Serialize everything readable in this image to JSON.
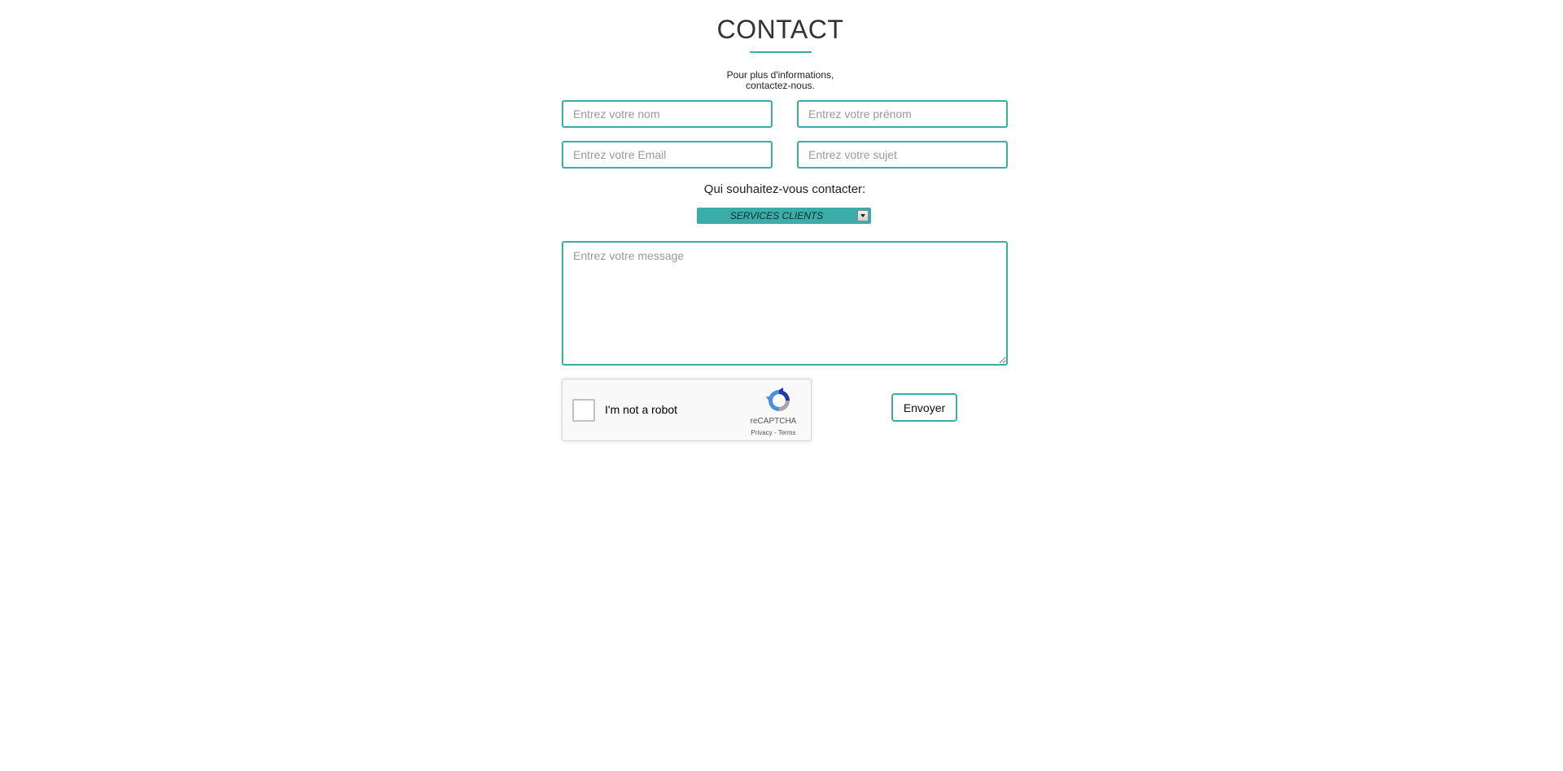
{
  "header": {
    "title": "CONTACT",
    "subtitle_line1": "Pour plus d'informations,",
    "subtitle_line2": "contactez-nous."
  },
  "form": {
    "nom_placeholder": "Entrez votre nom",
    "prenom_placeholder": "Entrez votre prénom",
    "email_placeholder": "Entrez votre Email",
    "sujet_placeholder": "Entrez votre sujet",
    "question": "Qui souhaitez-vous contacter:",
    "recipient_selected": "SERVICES CLIENTS",
    "message_placeholder": "Entrez votre message",
    "submit_label": "Envoyer"
  },
  "recaptcha": {
    "label": "I'm not a robot",
    "brand": "reCAPTCHA",
    "links": "Privacy - Terms",
    "icon": "recaptcha-logo-icon"
  },
  "colors": {
    "accent": "#3aada8"
  }
}
